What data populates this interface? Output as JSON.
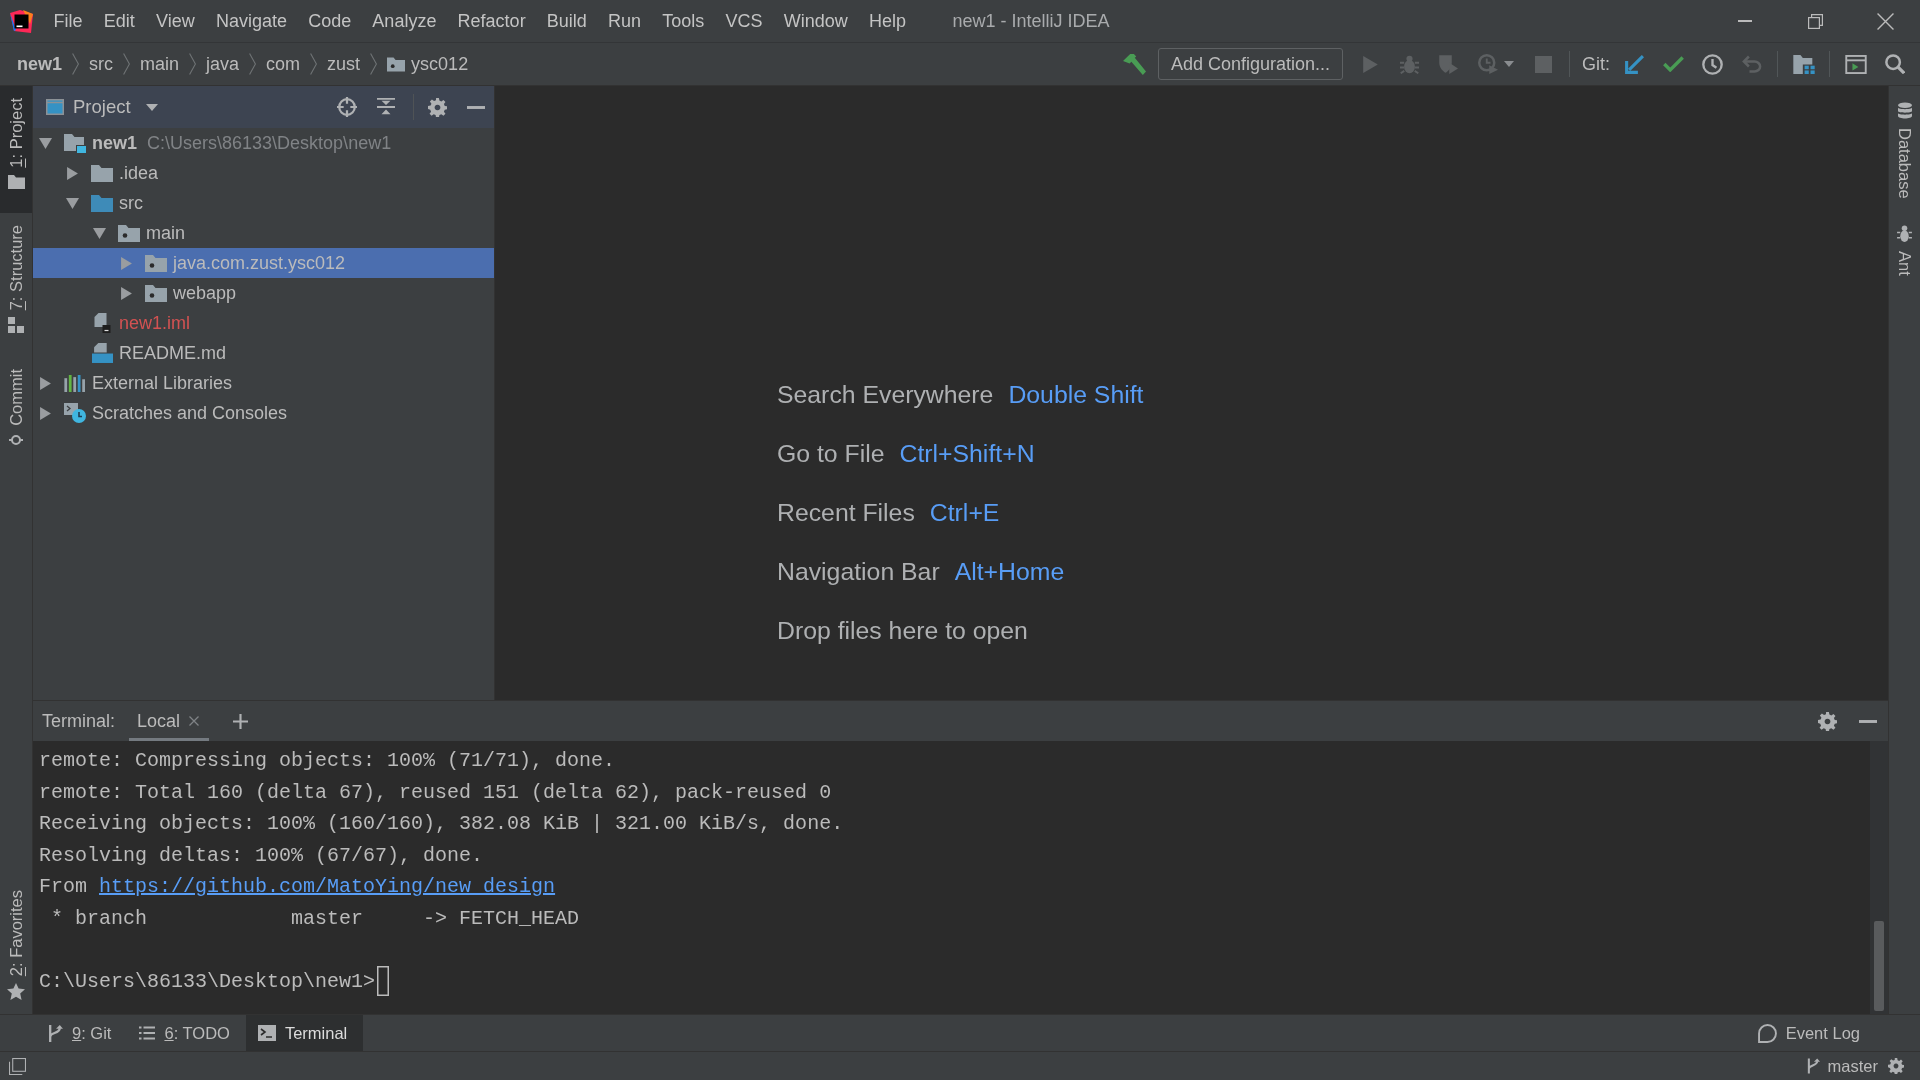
{
  "window": {
    "title": "new1 - IntelliJ IDEA"
  },
  "menu": [
    "File",
    "Edit",
    "View",
    "Navigate",
    "Code",
    "Analyze",
    "Refactor",
    "Build",
    "Run",
    "Tools",
    "VCS",
    "Window",
    "Help"
  ],
  "breadcrumbs": [
    "new1",
    "src",
    "main",
    "java",
    "com",
    "zust",
    "ysc012"
  ],
  "toolbar": {
    "configuration": "Add Configuration...",
    "run_actions": [
      {
        "kind": "run",
        "disabled": true
      },
      {
        "kind": "debug",
        "disabled": true
      },
      {
        "kind": "coverage",
        "disabled": true
      },
      {
        "kind": "profile",
        "disabled": true
      },
      {
        "kind": "stop",
        "disabled": true
      }
    ],
    "vcs_label": "Git:",
    "vcs_actions": [
      {
        "kind": "update",
        "disabled": false
      },
      {
        "kind": "commit",
        "disabled": false
      },
      {
        "kind": "history",
        "disabled": false
      },
      {
        "kind": "rollback",
        "disabled": true
      }
    ]
  },
  "left_strip": [
    {
      "kind": "project",
      "label": "1: Project",
      "mnemonic": true,
      "selected": true
    },
    {
      "kind": "structure",
      "label": "7: Structure",
      "mnemonic": true,
      "selected": false
    },
    {
      "kind": "commit",
      "label": "Commit",
      "mnemonic": false,
      "selected": false
    }
  ],
  "left_strip_bottom": [
    {
      "kind": "favorites",
      "label": "2: Favorites",
      "mnemonic": true,
      "selected": false
    }
  ],
  "right_strip": [
    {
      "kind": "database",
      "label": "Database",
      "selected": false
    },
    {
      "kind": "ant",
      "label": "Ant",
      "selected": false
    }
  ],
  "project_panel": {
    "title": "Project",
    "tree": [
      {
        "kind": "module",
        "name": "new1",
        "path": "C:\\Users\\86133\\Desktop\\new1",
        "expanded": true,
        "selected": false,
        "children": [
          {
            "kind": "folder",
            "name": ".idea",
            "expanded": false,
            "selected": false
          },
          {
            "kind": "sources",
            "name": "src",
            "expanded": true,
            "selected": false,
            "children": [
              {
                "kind": "package",
                "name": "main",
                "expanded": true,
                "selected": false,
                "children": [
                  {
                    "kind": "package",
                    "name": "java.com.zust.ysc012",
                    "expanded": false,
                    "selected": true
                  },
                  {
                    "kind": "package",
                    "name": "webapp",
                    "expanded": false,
                    "selected": false
                  }
                ]
              }
            ]
          },
          {
            "kind": "iml",
            "name": "new1.iml",
            "selected": false,
            "color": "#d25252"
          },
          {
            "kind": "markdown",
            "name": "README.md",
            "selected": false
          }
        ]
      },
      {
        "kind": "libraries",
        "name": "External Libraries",
        "expanded": false,
        "selected": false
      },
      {
        "kind": "scratches",
        "name": "Scratches and Consoles",
        "expanded": false,
        "selected": false
      }
    ]
  },
  "editor_hints": [
    {
      "label": "Search Everywhere",
      "shortcut": "Double Shift"
    },
    {
      "label": "Go to File",
      "shortcut": "Ctrl+Shift+N"
    },
    {
      "label": "Recent Files",
      "shortcut": "Ctrl+E"
    },
    {
      "label": "Navigation Bar",
      "shortcut": "Alt+Home"
    },
    {
      "label": "Drop files here to open"
    }
  ],
  "terminal": {
    "label": "Terminal:",
    "tabs": [
      {
        "label": "Local",
        "selected": true
      }
    ],
    "lines": [
      {
        "text": "remote: Compressing objects: 100% (71/71), done."
      },
      {
        "text": "remote: Total 160 (delta 67), reused 151 (delta 62), pack-reused 0"
      },
      {
        "text": "Receiving objects: 100% (160/160), 382.08 KiB | 321.00 KiB/s, done."
      },
      {
        "text": "Resolving deltas: 100% (67/67), done."
      },
      {
        "text": "From ",
        "link": "https://github.com/MatoYing/new_design"
      },
      {
        "text": " * branch            master     -> FETCH_HEAD"
      }
    ],
    "prompt": "C:\\Users\\86133\\Desktop\\new1>"
  },
  "bottom_tabs": [
    {
      "kind": "git",
      "label": "9: Git",
      "mnemonic": true,
      "selected": false
    },
    {
      "kind": "todo",
      "label": "6: TODO",
      "mnemonic": true,
      "selected": false
    },
    {
      "kind": "terminal",
      "label": "Terminal",
      "mnemonic": false,
      "selected": true
    }
  ],
  "event_log": "Event Log",
  "status_bar": {
    "branch": "master"
  }
}
